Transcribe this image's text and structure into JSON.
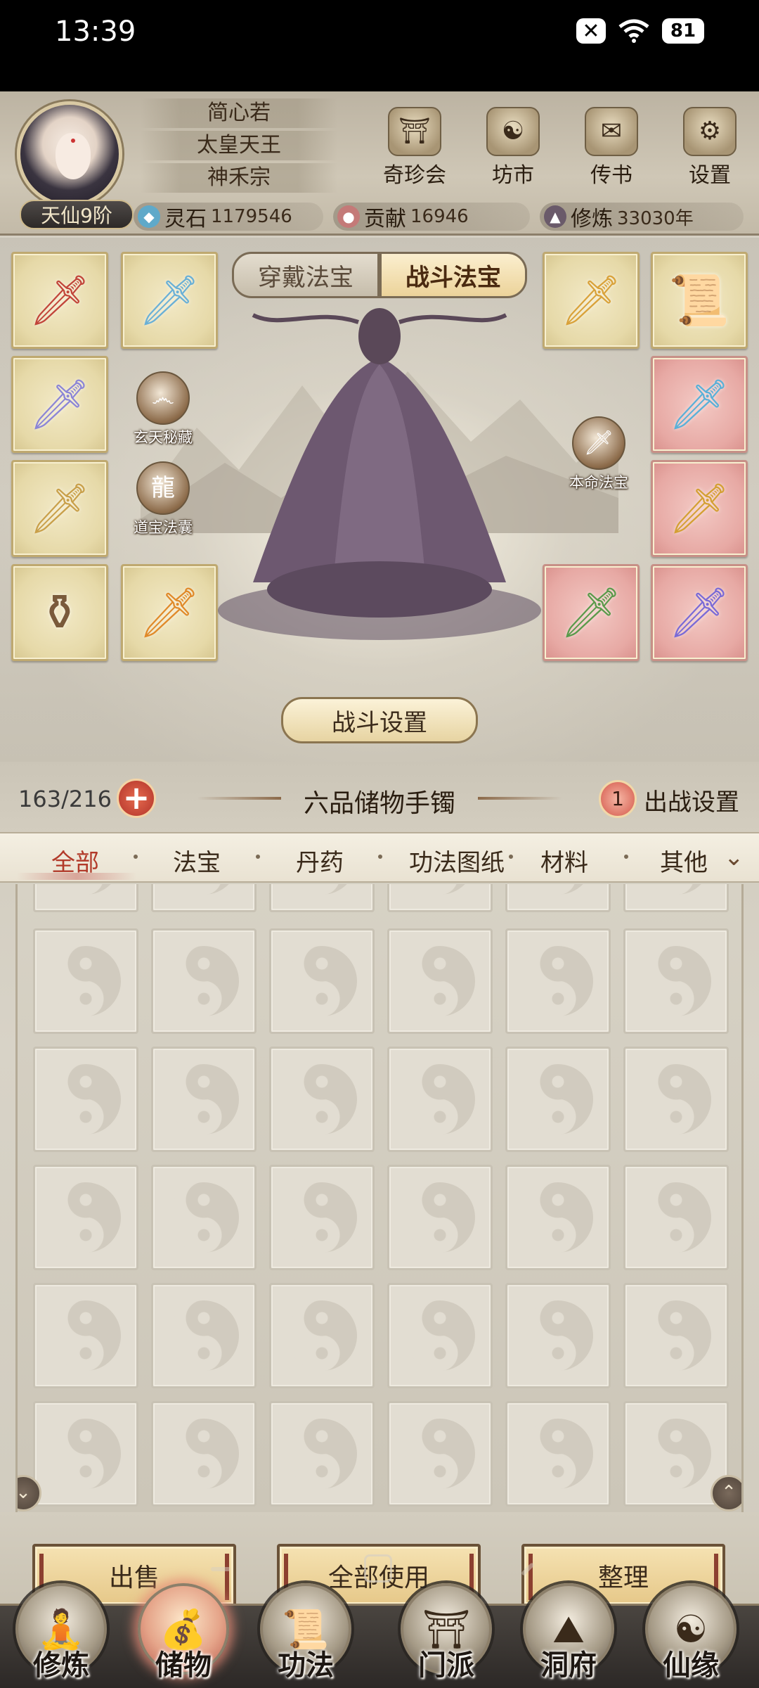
{
  "status_bar": {
    "time": "13:39",
    "battery": "81",
    "x_glyph": "✕"
  },
  "profile": {
    "name": "简心若",
    "title": "太皇天王",
    "sect": "神禾宗",
    "rank": "天仙9阶"
  },
  "top_buttons": [
    {
      "label": "奇珍会",
      "icon": "treasure-pavilion-icon",
      "glyph": "⛩"
    },
    {
      "label": "坊市",
      "icon": "market-icon",
      "glyph": "☯"
    },
    {
      "label": "传书",
      "icon": "scroll-letter-icon",
      "glyph": "✉"
    },
    {
      "label": "设置",
      "icon": "gear-icon",
      "glyph": "⚙"
    }
  ],
  "resources": [
    {
      "label": "灵石",
      "value": "1179546",
      "icon": "spirit-stone-icon",
      "color": "#5fa9c9"
    },
    {
      "label": "贡献",
      "value": "16946",
      "icon": "contribution-icon",
      "color": "#c47a78"
    },
    {
      "label": "修炼",
      "value": "33030年",
      "icon": "cultivation-icon",
      "color": "#6a5a6a"
    }
  ],
  "equip_tabs": {
    "left": "穿戴法宝",
    "right": "战斗法宝",
    "active": "战斗法宝"
  },
  "side_orbs": {
    "xuantian": "玄天秘藏",
    "daobao": "道宝法囊",
    "benming": "本命法宝"
  },
  "equip_slots": {
    "left": [
      {
        "item": "red-sword",
        "glyph": "🗡",
        "color": "#c2453a",
        "bg": "gold"
      },
      {
        "item": "blue-sword",
        "glyph": "🗡",
        "color": "#6ab0d6",
        "bg": "gold"
      },
      {
        "item": "wind-sword",
        "glyph": "🗡",
        "color": "#8b85d6",
        "bg": "gold"
      },
      {
        "item": "golden-sword",
        "glyph": "🗡",
        "color": "#c9a04a",
        "bg": "gold"
      },
      {
        "item": "cauldron",
        "glyph": "⚱",
        "color": "#7a5a3a",
        "bg": "gold"
      },
      {
        "item": "flame-sword",
        "glyph": "🗡",
        "color": "#e08a2a",
        "bg": "gold"
      }
    ],
    "right": [
      {
        "item": "golden-blade",
        "glyph": "🗡",
        "color": "#d9a23a",
        "bg": "gold"
      },
      {
        "item": "purple-scroll",
        "glyph": "📜",
        "color": "#a78ad6",
        "bg": "gold"
      },
      {
        "item": "ice-sword",
        "glyph": "🗡",
        "color": "#5ab0d8",
        "bg": "red"
      },
      {
        "item": "golden-spear",
        "glyph": "🗡",
        "color": "#d4a034",
        "bg": "red"
      },
      {
        "item": "jade-sword",
        "glyph": "🗡",
        "color": "#5a9a4a",
        "bg": "red"
      },
      {
        "item": "violet-sword",
        "glyph": "🗡",
        "color": "#7a6ad6",
        "bg": "red"
      }
    ]
  },
  "battle_settings_button": "战斗设置",
  "bag": {
    "count": "163/216",
    "plus": "+",
    "name": "六品储物手镯",
    "deploy_count": "1",
    "deploy_label": "出战设置"
  },
  "categories": [
    "全部",
    "法宝",
    "丹药",
    "功法图纸",
    "材料",
    "其他"
  ],
  "active_category": "全部",
  "grid": {
    "columns": 6,
    "visible_rows": 5,
    "empty": true
  },
  "actions": {
    "sell": "出售",
    "use_all": "全部使用",
    "sort": "整理"
  },
  "bottom_nav": [
    {
      "label": "修炼",
      "icon": "meditation-icon",
      "glyph": "🧘"
    },
    {
      "label": "储物",
      "icon": "bag-icon",
      "glyph": "💰",
      "active": true
    },
    {
      "label": "功法",
      "icon": "scroll-book-icon",
      "glyph": "📜"
    },
    {
      "label": "门派",
      "icon": "sect-gate-icon",
      "glyph": "⛩"
    },
    {
      "label": "洞府",
      "icon": "mountain-cave-icon",
      "glyph": "⛰"
    },
    {
      "label": "仙缘",
      "icon": "fate-orb-icon",
      "glyph": "☯"
    }
  ]
}
